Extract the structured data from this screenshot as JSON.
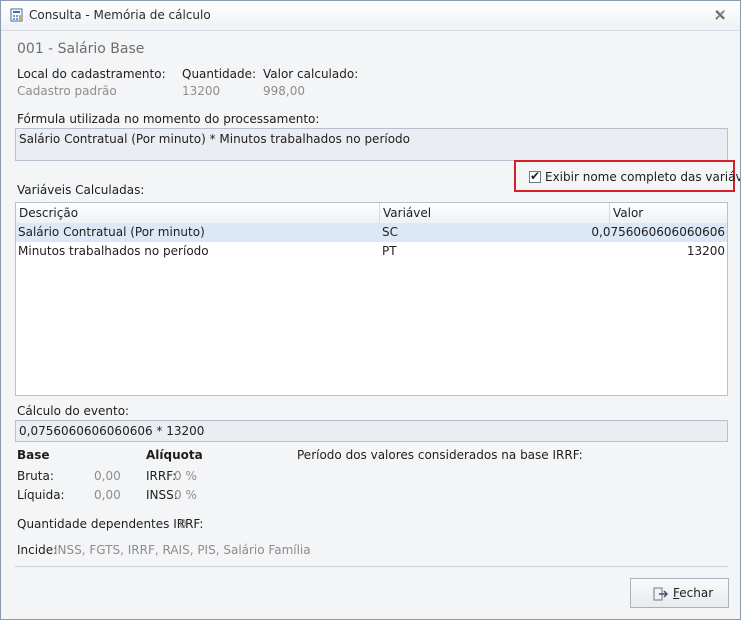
{
  "window": {
    "title": "Consulta - Memória de cálculo",
    "icon": "calculator-form-icon",
    "close_icon": "close-icon"
  },
  "event": {
    "name": "001 - Salário Base"
  },
  "info": {
    "local_label": "Local do cadastramento:",
    "local_value": "Cadastro padrão",
    "quantidade_label": "Quantidade:",
    "quantidade_value": "13200",
    "valor_label": "Valor calculado:",
    "valor_value": "998,00"
  },
  "formula": {
    "label": "Fórmula utilizada no momento do processamento:",
    "value": "Salário Contratual (Por minuto) * Minutos trabalhados no período"
  },
  "checkbox": {
    "label": "Exibir nome completo das variáveis",
    "checked": true
  },
  "variables": {
    "label": "Variáveis Calculadas:",
    "columns": [
      "Descrição",
      "Variável",
      "Valor"
    ],
    "rows": [
      {
        "descricao": "Salário Contratual (Por minuto)",
        "variavel": "SC",
        "valor": "0,0756060606060606",
        "selected": true
      },
      {
        "descricao": "Minutos trabalhados no período",
        "variavel": "PT",
        "valor": "13200",
        "selected": false
      }
    ]
  },
  "calculo": {
    "label": "Cálculo do evento:",
    "value": "0,0756060606060606 * 13200"
  },
  "base": {
    "header": "Base",
    "bruta_label": "Bruta:",
    "bruta_value": "0,00",
    "liquida_label": "Líquida:",
    "liquida_value": "0,00"
  },
  "aliquota": {
    "header": "Alíquota",
    "irrf_label": "IRRF:",
    "irrf_value": "0 %",
    "inss_label": "INSS:",
    "inss_value": "0 %"
  },
  "periodo": {
    "label": "Período dos valores considerados na base IRRF:"
  },
  "dependentes": {
    "label": "Quantidade dependentes IRRF:",
    "value": "0"
  },
  "incide": {
    "label": "Incide:",
    "value": "INSS, FGTS, IRRF, RAIS, PIS, Salário Família"
  },
  "buttons": {
    "fechar": "Fechar",
    "fechar_icon": "exit-door-icon"
  },
  "colors": {
    "highlight_border": "#d5202a",
    "selected_row": "#dde8f6"
  }
}
